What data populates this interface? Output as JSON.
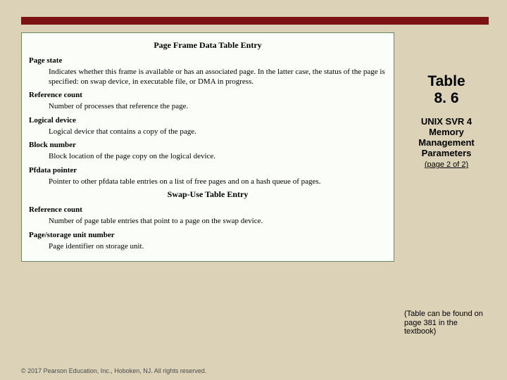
{
  "accent": {
    "rule_color": "#7c1212",
    "card_border": "#6a8a5a"
  },
  "card": {
    "section1_title": "Page Frame Data Table Entry",
    "entries1": [
      {
        "term": "Page state",
        "desc": "Indicates whether this frame is available or has an associated page. In the latter case, the status of the page is specified: on swap device, in executable file, or DMA in progress."
      },
      {
        "term": "Reference count",
        "desc": "Number of processes that reference the page."
      },
      {
        "term": "Logical device",
        "desc": "Logical device that contains a copy of the page."
      },
      {
        "term": "Block number",
        "desc": "Block location of the page copy on the logical device."
      },
      {
        "term": "Pfdata pointer",
        "desc": "Pointer to other pfdata table entries on a list of free pages and on a hash queue of pages."
      }
    ],
    "section2_title": "Swap-Use Table Entry",
    "entries2": [
      {
        "term": "Reference count",
        "desc": "Number of page table entries that point to a page on the swap device."
      },
      {
        "term": "Page/storage unit number",
        "desc": "Page identifier on storage unit."
      }
    ]
  },
  "sidebar": {
    "label_line1": "Table",
    "label_line2": "8. 6",
    "caption": "UNIX SVR 4 Memory Management Parameters",
    "page_note": "(page 2 of 2)"
  },
  "note": "(Table can be found on page 381 in the textbook)",
  "footer": "© 2017 Pearson Education, Inc., Hoboken, NJ. All rights reserved."
}
